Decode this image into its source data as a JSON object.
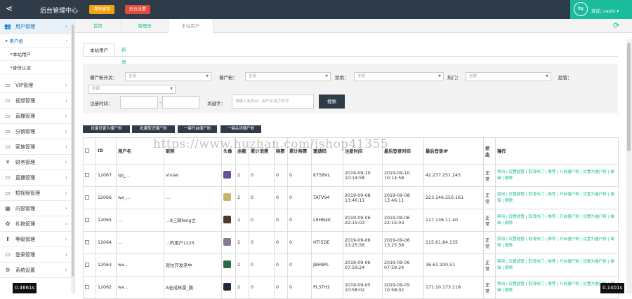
{
  "header": {
    "title": "后台管理中心",
    "btn1": "清除缓存",
    "btn2": "后台设置",
    "user": "欢迎, ceshi",
    "btn1_color": "#f0a30a",
    "btn2_color": "#e04b3a",
    "accent": "#1bbc9b"
  },
  "sidebar": {
    "items": [
      {
        "label": "用户管理",
        "icon": "users-icon"
      },
      {
        "label": "VIP管理",
        "icon": "monitor-icon"
      },
      {
        "label": "视频管理",
        "icon": "monitor-icon"
      },
      {
        "label": "直播管理",
        "icon": "monitor-icon"
      },
      {
        "label": "分销管理",
        "icon": "monitor-icon"
      },
      {
        "label": "家族管理",
        "icon": "monitor-icon"
      },
      {
        "label": "财务管理",
        "icon": "yen-icon"
      },
      {
        "label": "直播管理",
        "icon": "monitor-icon"
      },
      {
        "label": "短视频管理",
        "icon": "monitor-icon"
      },
      {
        "label": "内容管理",
        "icon": "grid-icon"
      },
      {
        "label": "礼物管理",
        "icon": "gift-icon"
      },
      {
        "label": "等级管理",
        "icon": "upload-icon"
      },
      {
        "label": "登录管理",
        "icon": "monitor-icon"
      },
      {
        "label": "系统设置",
        "icon": "gear-icon"
      }
    ],
    "sub_group": "用户组",
    "sub_items": [
      "本站用户",
      "身份认证"
    ]
  },
  "page_tabs": [
    "首页",
    "管理员",
    "本站用户"
  ],
  "content_tabs": [
    "本站用户",
    "新增会员"
  ],
  "filters": {
    "label1": "僵尸粉开关：",
    "val1": "全部",
    "label2": "僵尸粉：",
    "val2": "全部",
    "label3": "禁用：",
    "val3": "全部",
    "label4": "热门：",
    "val4": "全部",
    "label5": "超管：",
    "val5": "全部",
    "reg_label": "注册时间：",
    "dash": "-",
    "kw_label": "关键字：",
    "kw_placeholder": "请输入会员id、用户名或手机号",
    "search": "搜索"
  },
  "actions": [
    "批量设置为僵尸粉",
    "批量取消僵尸粉",
    "一键开启僵尸粉",
    "一键关闭僵尸粉"
  ],
  "table": {
    "headers": [
      "",
      "ID",
      "用户名",
      "昵称",
      "头像",
      "余额",
      "累计消费",
      "映票",
      "累计映票",
      "邀请码",
      "注册时间",
      "最后登录时间",
      "最后登录IP",
      "状态",
      "操作"
    ],
    "rows": [
      {
        "id": "12067",
        "username": "qq_...",
        "nick": "vivian",
        "avatar_color": "#6b4fa0",
        "coin": "2",
        "spend": "0",
        "vote": "0",
        "votetotal": "0",
        "code": "K758VL",
        "reg": "2019-09-10 10:14:58",
        "last": "2019-09-10 10:14:58",
        "ip": "42.237.251.245",
        "status": "正常",
        "ops": "禁用 | 设置超管 | 取消热门 | 推荐 | 开启僵尸粉 | 设置为僵尸粉 | 编辑 | 删除"
      },
      {
        "id": "12066",
        "username": "wx_...",
        "nick": "...",
        "avatar_color": "#c9b56a",
        "coin": "2",
        "spend": "0",
        "vote": "0",
        "votetotal": "0",
        "code": "TATV94",
        "reg": "2019-09-08 13:46:11",
        "last": "2019-09-08 13:46:11",
        "ip": "223.146.250.161",
        "status": "正常",
        "ops": "禁用 | 设置超管 | 取消热门 | 推荐 | 开启僵尸粉 | 设置为僵尸粉 | 编辑 | 删除"
      },
      {
        "id": "12065",
        "username": "...",
        "nick": "...8三网feng之",
        "avatar_color": "#4a3b2c",
        "coin": "2",
        "spend": "0",
        "vote": "0",
        "votetotal": "0",
        "code": "L9HN4K",
        "reg": "2019-09-06 22:15:03",
        "last": "2019-09-06 22:15:03",
        "ip": "117.136.11.40",
        "status": "正常",
        "ops": "禁用 | 设置超管 | 取消热门 | 推荐 | 开启僵尸粉 | 设置为僵尸粉 | 编辑 | 删除"
      },
      {
        "id": "12064",
        "username": "...",
        "nick": "...的用户1225",
        "avatar_color": "#8a7b8e",
        "coin": "2",
        "spend": "0",
        "vote": "0",
        "votetotal": "0",
        "code": "HTI5DE",
        "reg": "2019-09-06 13:25:56",
        "last": "2019-09-06 13:25:56",
        "ip": "115.61.84.135",
        "status": "正常",
        "ops": "禁用 | 设置超管 | 取消热门 | 推荐 | 开启僵尸粉 | 设置为僵尸粉 | 编辑 | 删除"
      },
      {
        "id": "12063",
        "username": "wx...",
        "nick": "就拉开发老中",
        "avatar_color": "#2e6b4a",
        "coin": "2",
        "spend": "0",
        "vote": "0",
        "votetotal": "0",
        "code": "JBHBPL",
        "reg": "2019-09-06 07:59:24",
        "last": "2019-09-06 07:59:24",
        "ip": "36.61.100.51",
        "status": "正常",
        "ops": "禁用 | 设置超管 | 取消热门 | 推荐 | 开启僵尸粉 | 设置为僵尸粉 | 编辑 | 删除"
      },
      {
        "id": "12062",
        "username": "wx...",
        "nick": "A志成林景_魏",
        "avatar_color": "#1e2a3a",
        "coin": "2",
        "spend": "0",
        "vote": "0",
        "votetotal": "0",
        "code": "PL3TH2",
        "reg": "2019-09-05 10:58:02",
        "last": "2019-09-05 10:58:02",
        "ip": "171.10.173.118",
        "status": "正常",
        "ops": "禁用 | 设置超管 | 取消热门 | 推荐 | 开启僵尸粉 | 设置为僵尸粉 | 编辑 | 删除"
      }
    ]
  },
  "watermark": "https://www.huzhan.com/ishop41355",
  "timer_left": "0.4661s",
  "timer_right": "0.1401s"
}
